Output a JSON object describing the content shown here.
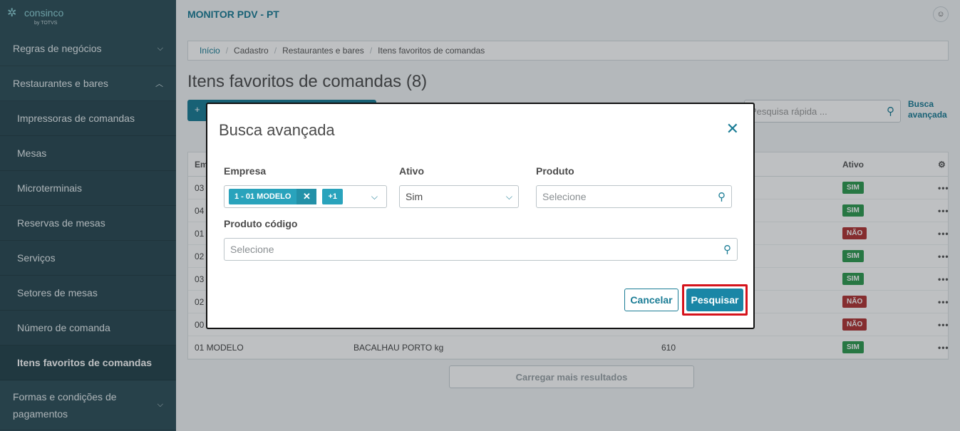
{
  "sidebar": {
    "logo": {
      "text": "consinco",
      "sub": "by TOTVS"
    },
    "items": [
      {
        "label": "Regras de negócios",
        "type": "group",
        "expanded": false
      },
      {
        "label": "Restaurantes e bares",
        "type": "group",
        "expanded": true
      },
      {
        "label": "Impressoras de comandas",
        "type": "sub"
      },
      {
        "label": "Mesas",
        "type": "sub"
      },
      {
        "label": "Microterminais",
        "type": "sub"
      },
      {
        "label": "Reservas de mesas",
        "type": "sub"
      },
      {
        "label": "Serviços",
        "type": "sub"
      },
      {
        "label": "Setores de mesas",
        "type": "sub"
      },
      {
        "label": "Número de comanda",
        "type": "sub"
      },
      {
        "label": "Itens favoritos de comandas",
        "type": "sub",
        "active": true
      },
      {
        "label": "Formas e condições de pagamentos",
        "type": "group",
        "expanded": false
      }
    ]
  },
  "header": {
    "app_title": "MONITOR PDV - PT"
  },
  "breadcrumb": [
    "Início",
    "Cadastro",
    "Restaurantes e bares",
    "Itens favoritos de comandas"
  ],
  "page": {
    "title": "Itens favoritos de comandas (8)",
    "quick_search_placeholder": "Pesquisa rápida ...",
    "advanced_link_line1": "Busca",
    "advanced_link_line2": "avançada",
    "load_more": "Carregar mais resultados"
  },
  "table": {
    "headers": {
      "empresa": "Em",
      "ativo": "Ativo"
    },
    "rows": [
      {
        "empresa": "03",
        "produto": "",
        "codigo": "",
        "ativo": "SIM"
      },
      {
        "empresa": "04",
        "produto": "",
        "codigo": "",
        "ativo": "SIM"
      },
      {
        "empresa": "01",
        "produto": "",
        "codigo": "",
        "ativo": "NÃO"
      },
      {
        "empresa": "02",
        "produto": "",
        "codigo": "",
        "ativo": "SIM"
      },
      {
        "empresa": "03",
        "produto": "",
        "codigo": "",
        "ativo": "SIM"
      },
      {
        "empresa": "02",
        "produto": "",
        "codigo": "",
        "ativo": "NÃO"
      },
      {
        "empresa": "00",
        "produto": "",
        "codigo": "",
        "ativo": "NÃO"
      },
      {
        "empresa": "01 MODELO",
        "produto": "BACALHAU PORTO kg",
        "codigo": "610",
        "ativo": "SIM"
      }
    ],
    "actions_label": "•••"
  },
  "modal": {
    "title": "Busca avançada",
    "close_icon": "close-icon",
    "empresa_label": "Empresa",
    "empresa_chip": "1 - 01 MODELO",
    "empresa_more": "+1",
    "ativo_label": "Ativo",
    "ativo_value": "Sim",
    "produto_label": "Produto",
    "produto_placeholder": "Selecione",
    "produto_codigo_label": "Produto código",
    "produto_codigo_placeholder": "Selecione",
    "cancel_label": "Cancelar",
    "search_label": "Pesquisar"
  },
  "colors": {
    "sidebar_bg": "#2e4f59",
    "accent": "#1a7c95",
    "chip": "#29a3bc",
    "highlight_border": "#d5131c",
    "badge_sim": "#2e9a50",
    "badge_nao": "#b03434"
  }
}
